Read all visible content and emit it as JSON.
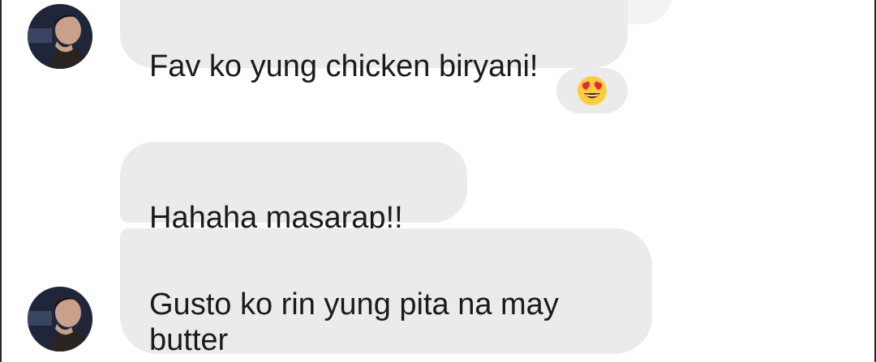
{
  "messages": [
    {
      "text": "Fav ko yung chicken biryani!"
    },
    {
      "text": "Hahaha masarap!!"
    },
    {
      "text": "Gusto ko rin yung pita na may\nbutter"
    }
  ],
  "reaction": {
    "emoji_name": "heart-eyes-emoji-icon"
  },
  "colors": {
    "bubble_bg": "#ebebeb",
    "text": "#1a1a1a",
    "emoji_face": "#ffcc3a",
    "emoji_hearts": "#e8263b"
  }
}
